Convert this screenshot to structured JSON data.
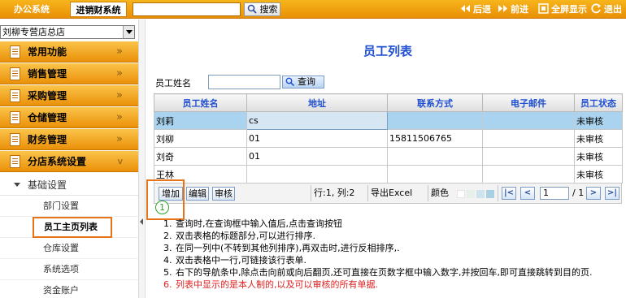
{
  "topbar": {
    "tab_oa": "办公系统",
    "tab_jxc": "进销财系统",
    "search_input_value": "",
    "search_button": "搜索",
    "nav_back": "后退",
    "nav_forward": "前进",
    "nav_fullscreen": "全屏显示",
    "nav_exit": "退出"
  },
  "sidebar": {
    "store_select": "刘柳专营店总店",
    "menu": [
      {
        "label": "常用功能"
      },
      {
        "label": "销售管理"
      },
      {
        "label": "采购管理"
      },
      {
        "label": "仓储管理"
      },
      {
        "label": "财务管理"
      },
      {
        "label": "分店系统设置"
      }
    ],
    "menu_chevron": "»",
    "open_chevron": "v",
    "sub_header": "基础设置",
    "sub_items": [
      "部门设置",
      "员工主页列表",
      "仓库设置",
      "系统选项",
      "资金账户"
    ],
    "active_sub_item": "员工主页列表"
  },
  "main": {
    "title": "员工列表",
    "name_label": "员工姓名",
    "name_input_value": "",
    "query_button": "查询",
    "grid": {
      "columns": [
        "员工姓名",
        "地址",
        "联系方式",
        "电子邮件",
        "员工状态"
      ],
      "rows": [
        [
          "刘莉",
          "cs",
          "",
          "",
          "未审核"
        ],
        [
          "刘柳",
          "01",
          "15811506765",
          "",
          "未审核"
        ],
        [
          "刘奇",
          "01",
          "",
          "",
          "未审核"
        ],
        [
          "王林",
          "",
          "",
          "",
          "未审核"
        ]
      ]
    },
    "toolbar": {
      "add": "增加",
      "edit": "编辑",
      "audit": "审核",
      "row_col": "行:1, 列:2",
      "export_excel": "导出Excel",
      "color_label": "颜色",
      "swatches": [
        "#ffffff",
        "#e6f0ea",
        "#cfe3ef",
        "#a8d0e2"
      ],
      "pager_first": "|<",
      "pager_prev": "<",
      "page_value": "1",
      "page_total": "/ 1",
      "pager_next": ">",
      "pager_last": ">|"
    },
    "step_marker": "1",
    "notes": [
      {
        "num": "1.",
        "text": "查询时,在查询框中输入值后,点击查询按钮",
        "red": false
      },
      {
        "num": "2.",
        "text": "双击表格的标题部分,可以进行排序.",
        "red": false
      },
      {
        "num": "3.",
        "text": "在同一列中(不转到其他列排序),再双击时,进行反相排序,.",
        "red": false
      },
      {
        "num": "4.",
        "text": "双击表格中一行,可链接该行表单.",
        "red": false
      },
      {
        "num": "5.",
        "text": "右下的导航条中,除点击向前或向后翻页,还可直接在页数字框中输入数字,并按回车,即可直接跳转到目的页.",
        "red": false
      },
      {
        "num": "6.",
        "text": "列表中显示的是本人制的,以及可以审核的所有单据.",
        "red": true
      }
    ]
  }
}
